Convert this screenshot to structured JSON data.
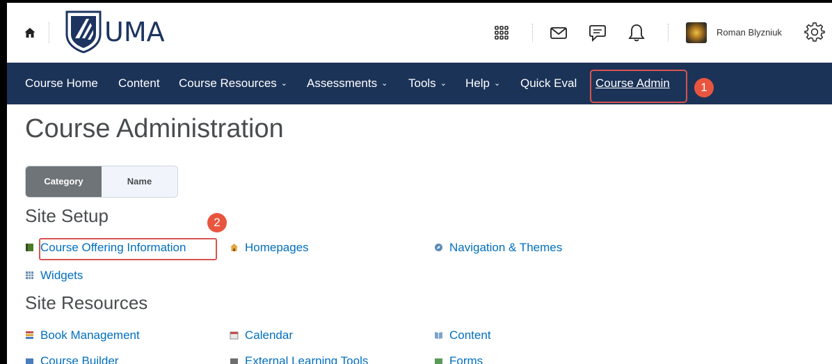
{
  "header": {
    "logo_text": "UMA",
    "user_name": "Roman Blyzniuk"
  },
  "nav": {
    "items": [
      {
        "label": "Course Home"
      },
      {
        "label": "Content"
      },
      {
        "label": "Course Resources",
        "dropdown": true
      },
      {
        "label": "Assessments",
        "dropdown": true
      },
      {
        "label": "Tools",
        "dropdown": true
      },
      {
        "label": "Help",
        "dropdown": true
      },
      {
        "label": "Quick Eval"
      },
      {
        "label": "Course Admin",
        "active": true
      }
    ],
    "chevron": "⌄"
  },
  "annotations": {
    "step1": "1",
    "step2": "2"
  },
  "page": {
    "title": "Course Administration",
    "view_toggle": {
      "category": "Category",
      "name": "Name"
    }
  },
  "sections": {
    "site_setup": {
      "heading": "Site Setup",
      "tools": [
        {
          "label": "Course Offering Information",
          "icon": "book-green-icon"
        },
        {
          "label": "Homepages",
          "icon": "house-icon"
        },
        {
          "label": "Navigation & Themes",
          "icon": "compass-icon"
        },
        {
          "label": "Widgets",
          "icon": "widget-grid-icon"
        }
      ]
    },
    "site_resources": {
      "heading": "Site Resources",
      "tools": [
        {
          "label": "Book Management",
          "icon": "books-icon"
        },
        {
          "label": "Calendar",
          "icon": "calendar-icon"
        },
        {
          "label": "Content",
          "icon": "open-book-icon"
        },
        {
          "label": "Course Builder",
          "icon": "builder-icon"
        },
        {
          "label": "External Learning Tools",
          "icon": "external-tools-icon"
        },
        {
          "label": "Forms",
          "icon": "forms-icon"
        }
      ]
    }
  },
  "colors": {
    "nav_bg": "#1c3358",
    "link": "#006fbf",
    "annotation": "#e8553f",
    "heading": "#494c4e"
  }
}
